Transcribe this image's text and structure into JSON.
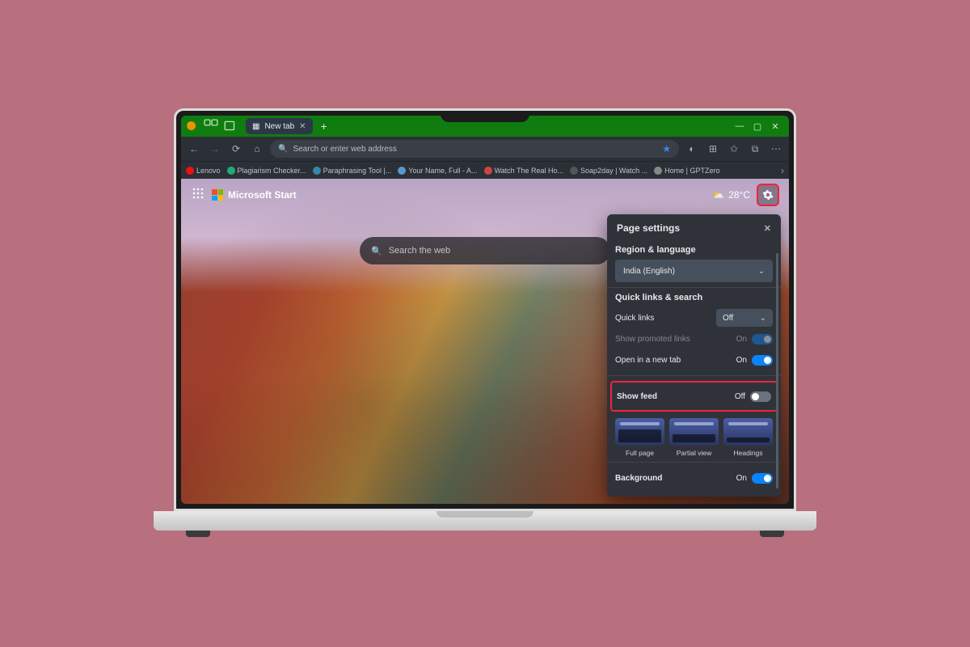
{
  "colors": {
    "highlight": "#ef233c",
    "accent": "#0a84ff",
    "titlebar": "#107c10"
  },
  "titlebar": {
    "tab_label": "New tab",
    "new_tab_glyph": "+",
    "minimize": "—",
    "maximize": "▢",
    "close": "✕"
  },
  "urlbar": {
    "back": "←",
    "forward": "→",
    "refresh": "⟳",
    "home": "⌂",
    "search_glyph": "🔍",
    "placeholder": "Search or enter web address",
    "star": "★"
  },
  "bookmarks": [
    "Lenovo",
    "Plagiarism Checker...",
    "Paraphrasing Tool |...",
    "Your Name, Full - A...",
    "Watch The Real Ho...",
    "Soap2day | Watch ...",
    "Home | GPTZero"
  ],
  "startpage": {
    "brand": "Microsoft Start",
    "weather_temp": "28°C",
    "search_placeholder": "Search the web"
  },
  "panel": {
    "title": "Page settings",
    "region_label": "Region & language",
    "region_value": "India (English)",
    "quicklinks_section": "Quick links & search",
    "quick_links_label": "Quick links",
    "quick_links_value": "Off",
    "promoted_label": "Show promoted links",
    "promoted_state": "On",
    "open_new_tab_label": "Open in a new tab",
    "open_new_tab_state": "On",
    "show_feed_label": "Show feed",
    "show_feed_state": "Off",
    "layouts": [
      "Full page",
      "Partial view",
      "Headings"
    ],
    "background_label": "Background",
    "background_state": "On"
  }
}
